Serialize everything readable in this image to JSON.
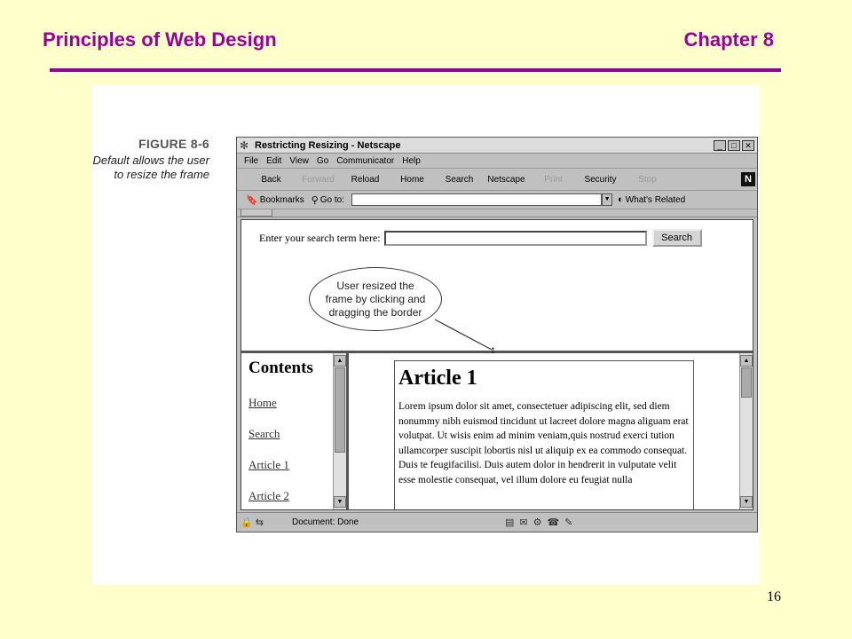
{
  "slide": {
    "title": "Principles of Web Design",
    "chapter": "Chapter 8",
    "page_number": "16",
    "accent_color": "#990099",
    "background_color": "#ffffcc"
  },
  "figure": {
    "number": "FIGURE 8-6",
    "caption_line1": "Default allows the user",
    "caption_line2": "to resize the frame"
  },
  "browser": {
    "title": "Restricting Resizing - Netscape",
    "menu": [
      "File",
      "Edit",
      "View",
      "Go",
      "Communicator",
      "Help"
    ],
    "toolbar": [
      {
        "label": "Back",
        "enabled": true
      },
      {
        "label": "Forward",
        "enabled": false
      },
      {
        "label": "Reload",
        "enabled": true
      },
      {
        "label": "Home",
        "enabled": true
      },
      {
        "label": "Search",
        "enabled": true
      },
      {
        "label": "Netscape",
        "enabled": true
      },
      {
        "label": "Print",
        "enabled": false
      },
      {
        "label": "Security",
        "enabled": true
      },
      {
        "label": "Stop",
        "enabled": false
      }
    ],
    "bookmarks_label": "Bookmarks",
    "goto_label": "Go to:",
    "goto_value": "",
    "whats_related_label": "What's Related",
    "status_text": "Document: Done"
  },
  "top_frame": {
    "search_prompt": "Enter your search term here:",
    "search_value": "",
    "search_button": "Search",
    "callout_line1": "User resized the",
    "callout_line2": "frame by clicking and",
    "callout_line3": "dragging the border"
  },
  "left_frame": {
    "heading": "Contents",
    "links": [
      "Home",
      "Search",
      "Article 1",
      "Article 2"
    ]
  },
  "right_frame": {
    "article_title": "Article 1",
    "article_body": "Lorem ipsum dolor sit amet, consectetuer adipiscing elit, sed diem nonummy nibh euismod tincidunt ut lacreet dolore magna aliguam erat volutpat. Ut wisis enim ad minim veniam,quis nostrud exerci tution ullamcorper suscipit lobortis nisl ut aliquip ex ea commodo consequat. Duis te feugifacilisi. Duis autem dolor in hendrerit in vulputate velit esse molestie consequat, vel illum dolore eu feugiat nulla"
  }
}
